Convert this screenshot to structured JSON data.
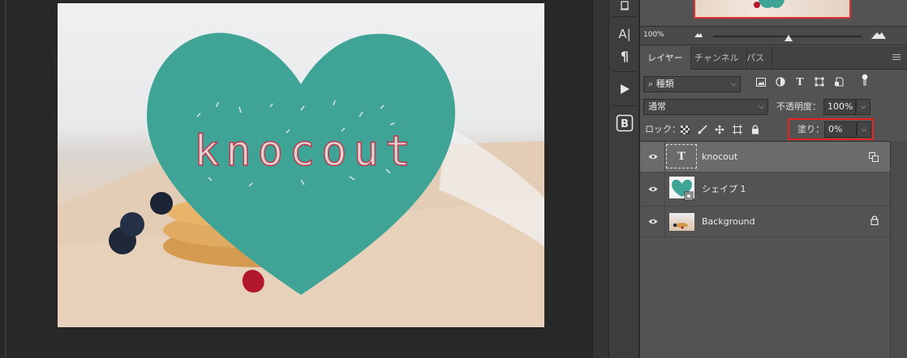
{
  "canvas": {
    "text_effect": "knocout"
  },
  "navigator": {
    "zoom": "100%"
  },
  "tabs": [
    {
      "label": "レイヤー",
      "active": true
    },
    {
      "label": "チャンネル",
      "active": false
    },
    {
      "label": "パス",
      "active": false
    }
  ],
  "filter": {
    "kind_label": "種類"
  },
  "blend": {
    "mode": "通常",
    "opacity_label": "不透明度：",
    "opacity_value": "100%"
  },
  "lock": {
    "label": "ロック：",
    "fill_label": "塗り：",
    "fill_value": "0%"
  },
  "layers": [
    {
      "name": "knocout",
      "type": "text",
      "selected": true
    },
    {
      "name": "シェイプ 1",
      "type": "shape",
      "selected": false
    },
    {
      "name": "Background",
      "type": "image",
      "selected": false
    }
  ],
  "colors": {
    "heart": "#3fa396",
    "highlight": "#e32222",
    "panel": "#535353"
  }
}
